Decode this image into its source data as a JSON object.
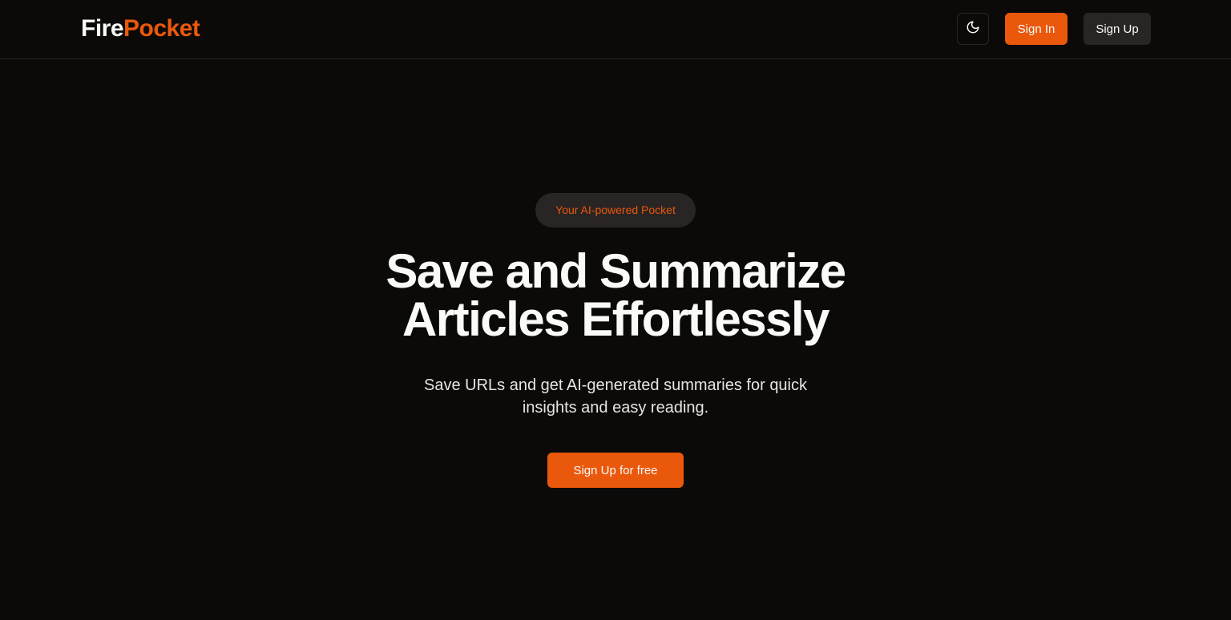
{
  "brand": {
    "name_part_1": "Fire",
    "name_part_2": "Pocket",
    "accent_color": "#ea580c"
  },
  "nav": {
    "theme_toggle_icon": "moon-icon",
    "sign_in_label": "Sign In",
    "sign_up_label": "Sign Up"
  },
  "hero": {
    "badge": "Your AI-powered Pocket",
    "headline_line_1": "Save and Summarize",
    "headline_line_2": "Articles Effortlessly",
    "subtext": "Save URLs and get AI-generated summaries for quick insights and easy reading.",
    "cta_label": "Sign Up for free"
  },
  "colors": {
    "background": "#0c0a09",
    "secondary_button": "#292524",
    "text": "#fafaf9"
  }
}
